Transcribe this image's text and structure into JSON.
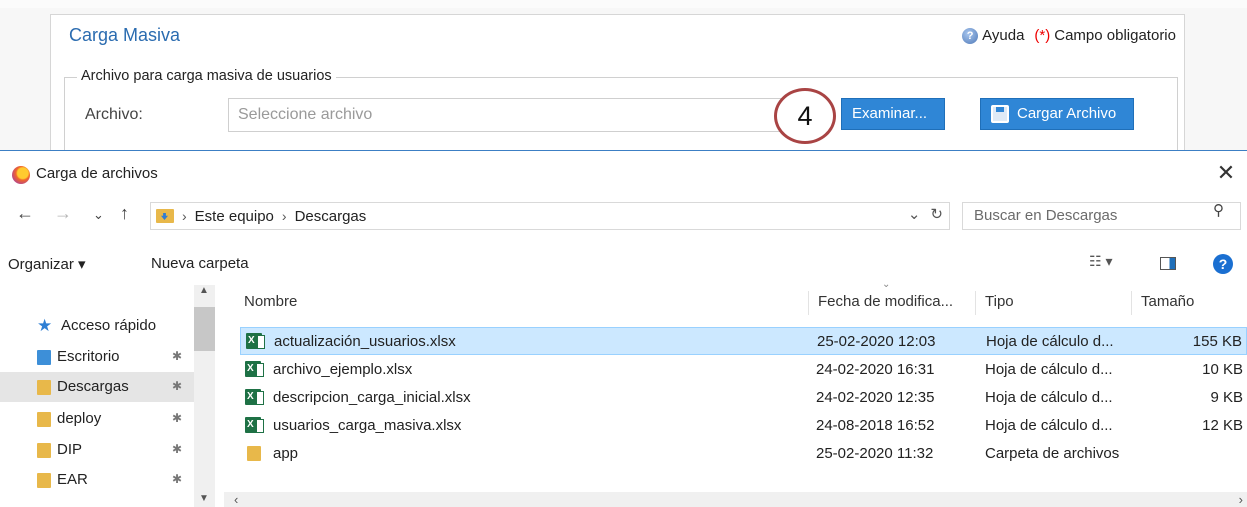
{
  "web_form": {
    "title": "Carga Masiva",
    "help_label": "Ayuda",
    "required_marker": "(*)",
    "required_label": "Campo obligatorio",
    "fieldset_legend": "Archivo para carga masiva de usuarios",
    "archivo_label": "Archivo:",
    "archivo_placeholder": "Seleccione archivo",
    "examinar_label": "Examinar...",
    "cargar_label": "Cargar Archivo",
    "step_number": "4"
  },
  "dialog": {
    "title": "Carga de archivos",
    "close_glyph": "✕",
    "breadcrumb": [
      "Este equipo",
      "Descargas"
    ],
    "search_placeholder": "Buscar en Descargas",
    "toolbar": {
      "organizar": "Organizar ▾",
      "nueva_carpeta": "Nueva carpeta"
    },
    "nav_pane": {
      "quick_access": "Acceso rápido",
      "items": [
        {
          "label": "Escritorio",
          "pinned": true
        },
        {
          "label": "Descargas",
          "pinned": true,
          "selected": true
        },
        {
          "label": "deploy",
          "pinned": true
        },
        {
          "label": "DIP",
          "pinned": true
        },
        {
          "label": "EAR",
          "pinned": true
        }
      ]
    },
    "columns": {
      "name": "Nombre",
      "date": "Fecha de modifica...",
      "type": "Tipo",
      "size": "Tamaño"
    },
    "files": [
      {
        "name": "actualización_usuarios.xlsx",
        "date": "25-02-2020 12:03",
        "type": "Hoja de cálculo d...",
        "size": "155 KB",
        "icon": "excel-icon",
        "selected": true
      },
      {
        "name": "archivo_ejemplo.xlsx",
        "date": "24-02-2020 16:31",
        "type": "Hoja de cálculo d...",
        "size": "10 KB",
        "icon": "excel-icon"
      },
      {
        "name": "descripcion_carga_inicial.xlsx",
        "date": "24-02-2020 12:35",
        "type": "Hoja de cálculo d...",
        "size": "9 KB",
        "icon": "excel-icon"
      },
      {
        "name": "usuarios_carga_masiva.xlsx",
        "date": "24-08-2018 16:52",
        "type": "Hoja de cálculo d...",
        "size": "12 KB",
        "icon": "excel-icon"
      },
      {
        "name": "app",
        "date": "25-02-2020 11:32",
        "type": "Carpeta de archivos",
        "size": "",
        "icon": "folder-icon"
      }
    ]
  },
  "colors": {
    "accent_blue": "#2f86d6",
    "title_blue": "#2b6cb0",
    "selection": "#cce8ff",
    "required_red": "#ee0000"
  }
}
